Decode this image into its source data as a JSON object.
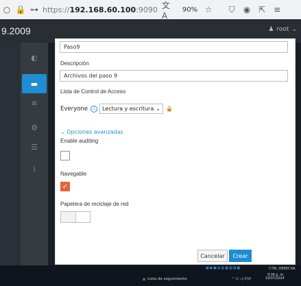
{
  "browser": {
    "url_prefix": "https://",
    "url_host": "192.168.60.100",
    "url_port": ":9090",
    "zoom": "90%"
  },
  "header": {
    "title": "9.2009",
    "user": "root"
  },
  "form": {
    "name_value": "Paso9",
    "description_label": "Descripción",
    "description_value": "Archivos del paso 9",
    "acl_label": "Lista de Control de Acceso",
    "acl_principal": "Everyone",
    "acl_permission": "Lectura y escritura",
    "advanced_toggle": "Opciones avanzadas",
    "enable_auditing_label": "Enable auditing",
    "enable_auditing_checked": false,
    "navegable_label": "Navegable",
    "navegable_checked": true,
    "recycle_label": "Papelera de reciclaje de red",
    "cancel_label": "Cancelar",
    "create_label": "Crear"
  },
  "taskbar": {
    "watchlist": "Lista de seguimiento",
    "tray_text": "CTRL DERECHA",
    "lang": "ESP",
    "time": "9:36 p. m.",
    "date": "19/07/2024"
  },
  "colors": {
    "accent": "#1e8dd4",
    "checkbox_checked": "#e2643c",
    "header_bg": "#292e34",
    "sidebar_bg": "#363b42"
  }
}
